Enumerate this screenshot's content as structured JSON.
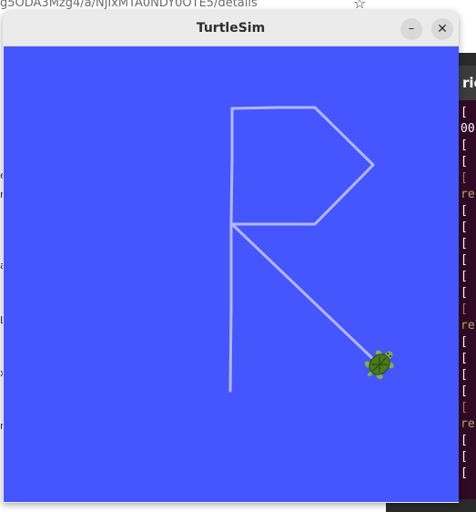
{
  "background_browser": {
    "url_fragment": "g5ODA3Mzg4/a/NjIxMTA0NDY0OTE5/details",
    "star_icon": "star-outline-icon",
    "page_text_fragments": [
      "e",
      "r",
      "a",
      "",
      "L",
      "x",
      "n"
    ]
  },
  "background_terminal": {
    "tab_text": "ric",
    "lines": [
      {
        "text": "[",
        "color": "#ffffff"
      },
      {
        "text": "00",
        "color": "#ffffff"
      },
      {
        "text": "[",
        "color": "#ffffff"
      },
      {
        "text": "[",
        "color": "#ffffff"
      },
      {
        "text": "[",
        "color": "#c07070"
      },
      {
        "text": "re",
        "color": "#c0a070"
      },
      {
        "text": "[",
        "color": "#ffffff"
      },
      {
        "text": "[",
        "color": "#ffffff"
      },
      {
        "text": "[",
        "color": "#ffffff"
      },
      {
        "text": "[",
        "color": "#ffffff"
      },
      {
        "text": "[",
        "color": "#ffffff"
      },
      {
        "text": "[",
        "color": "#ffffff"
      },
      {
        "text": "[",
        "color": "#c07070"
      },
      {
        "text": "re",
        "color": "#c0a070"
      },
      {
        "text": "[",
        "color": "#ffffff"
      },
      {
        "text": "[",
        "color": "#ffffff"
      },
      {
        "text": "[",
        "color": "#ffffff"
      },
      {
        "text": "[",
        "color": "#ffffff"
      },
      {
        "text": "[",
        "color": "#c07070"
      },
      {
        "text": "re",
        "color": "#c0a070"
      },
      {
        "text": "[",
        "color": "#ffffff"
      },
      {
        "text": "[",
        "color": "#ffffff"
      },
      {
        "text": "[",
        "color": "#ffffff"
      }
    ]
  },
  "window": {
    "title": "TurtleSim",
    "minimize_label": "–",
    "close_label": "✕",
    "minimize_icon": "minimize-icon",
    "close_icon": "close-icon"
  },
  "turtlesim": {
    "background_color": "#4556ff",
    "pen_color": "#b3b8ff",
    "turtle_icon": "turtle-icon",
    "turtle_color": "#4a7a1c"
  }
}
